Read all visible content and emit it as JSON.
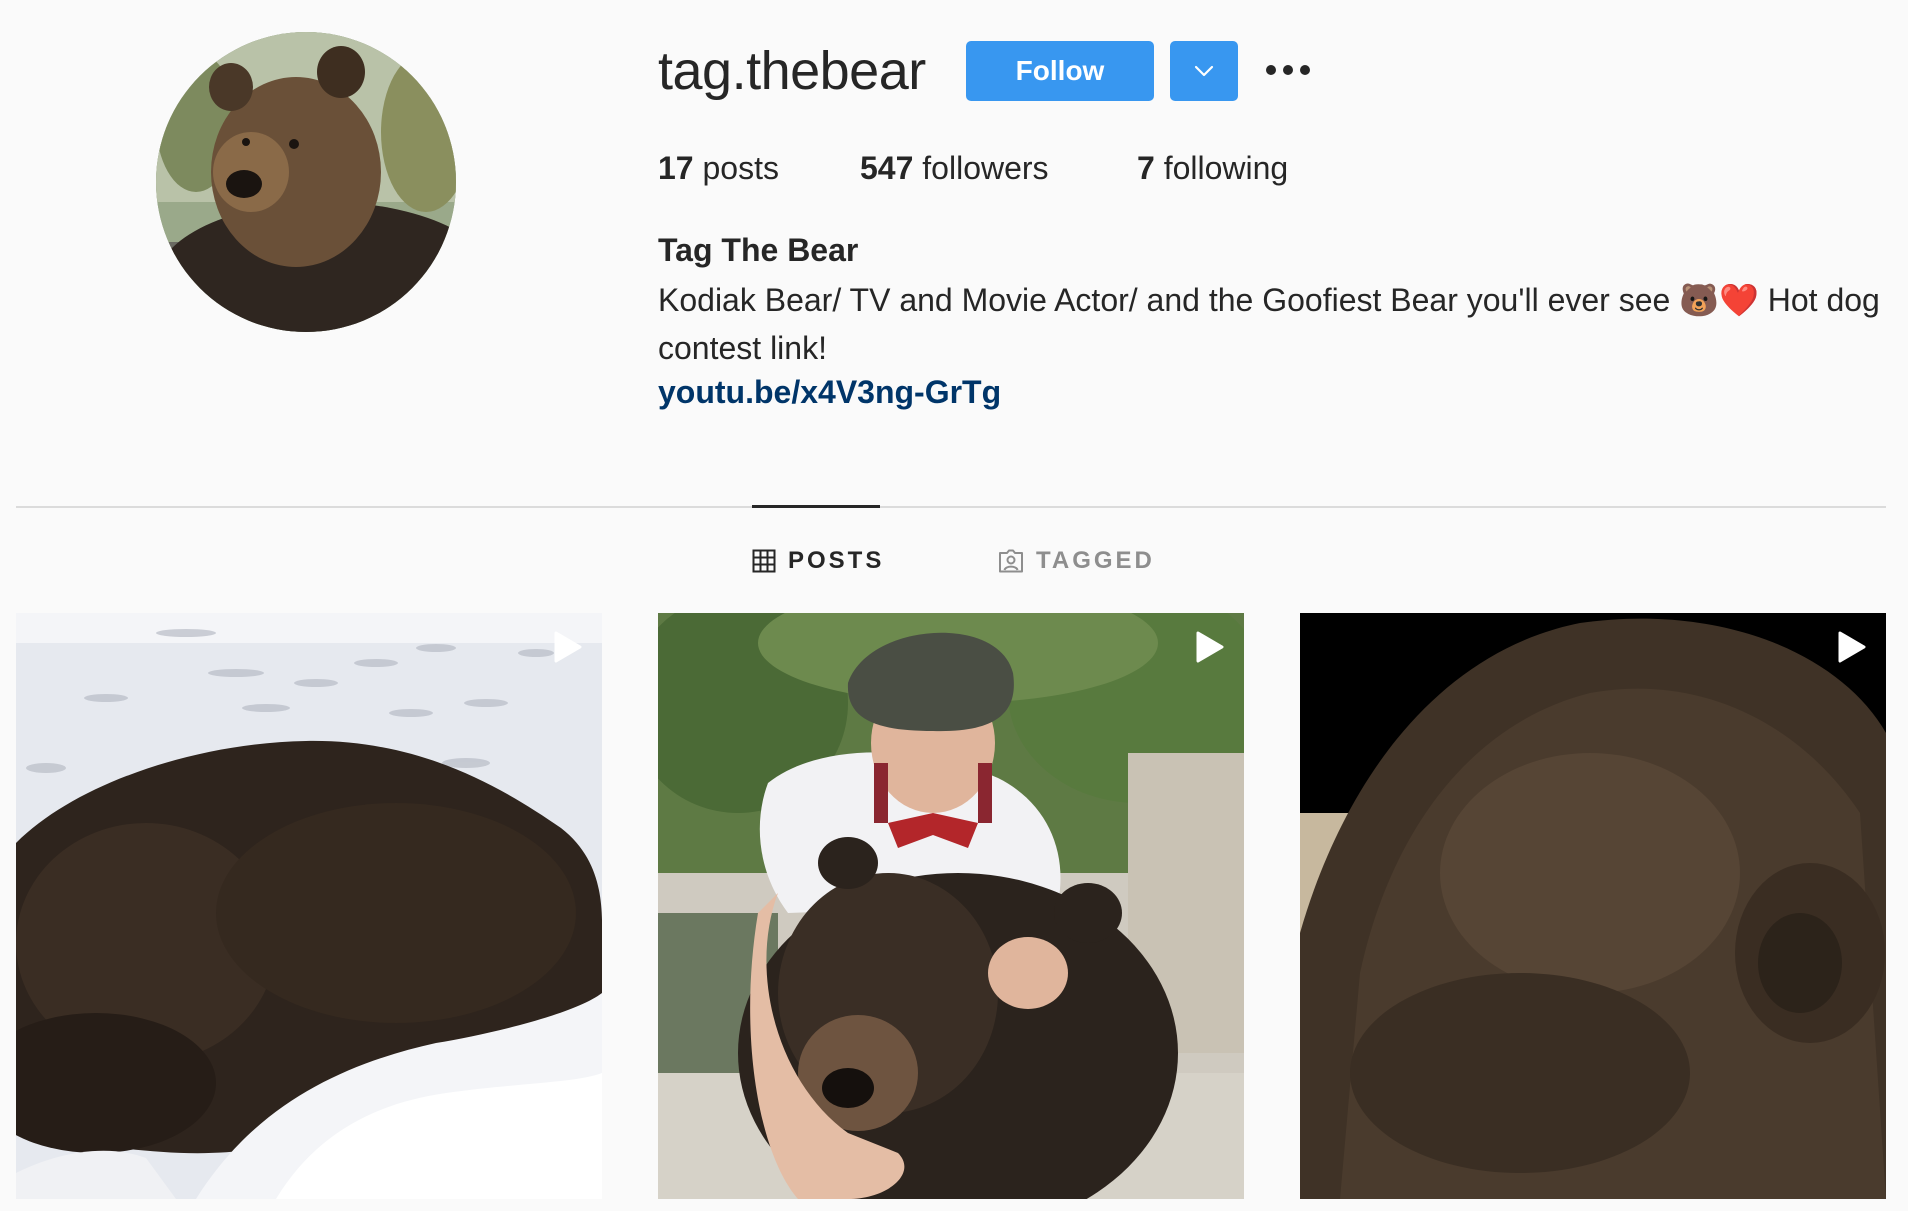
{
  "profile": {
    "username": "tag.thebear",
    "follow_label": "Follow",
    "stats": {
      "posts_count": "17",
      "posts_label": "posts",
      "followers_count": "547",
      "followers_label": "followers",
      "following_count": "7",
      "following_label": "following"
    },
    "full_name": "Tag The Bear",
    "bio": "Kodiak Bear/ TV and Movie Actor/ and the Goofiest Bear you'll ever see 🐻❤️ Hot dog contest link!",
    "link": "youtu.be/x4V3ng-GrTg"
  },
  "tabs": [
    {
      "label": "POSTS",
      "icon": "grid-icon",
      "active": true
    },
    {
      "label": "TAGGED",
      "icon": "tagged-icon",
      "active": false
    }
  ],
  "posts": [
    {
      "type": "video",
      "icon": "play-icon",
      "subject": "bear lying in snow"
    },
    {
      "type": "video",
      "icon": "play-icon",
      "subject": "man hugging bear"
    },
    {
      "type": "video",
      "icon": "play-icon",
      "subject": "bear close-up"
    }
  ],
  "colors": {
    "primary_button": "#3897f0",
    "link": "#003569",
    "text": "#262626",
    "muted": "#8e8e8e",
    "background": "#fafafa"
  }
}
